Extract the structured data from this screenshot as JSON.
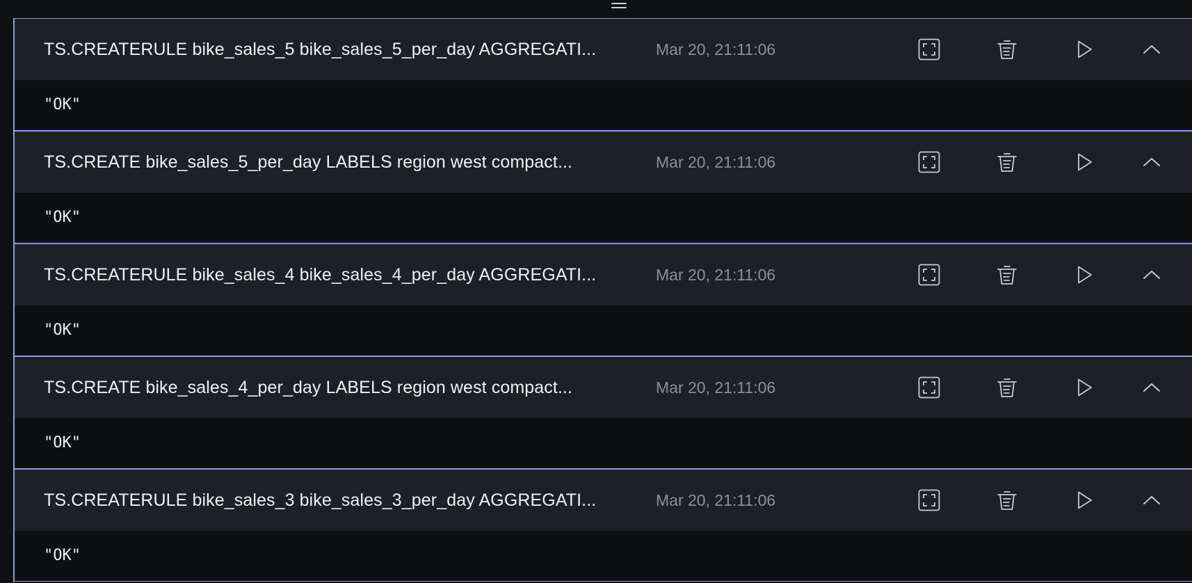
{
  "history": {
    "entries": [
      {
        "command": "TS.CREATERULE bike_sales_5 bike_sales_5_per_day AGGREGATI...",
        "timestamp": "Mar 20, 21:11:06",
        "result": "\"OK\""
      },
      {
        "command": "TS.CREATE bike_sales_5_per_day LABELS region west compact...",
        "timestamp": "Mar 20, 21:11:06",
        "result": "\"OK\""
      },
      {
        "command": "TS.CREATERULE bike_sales_4 bike_sales_4_per_day AGGREGATI...",
        "timestamp": "Mar 20, 21:11:06",
        "result": "\"OK\""
      },
      {
        "command": "TS.CREATE bike_sales_4_per_day LABELS region west compact...",
        "timestamp": "Mar 20, 21:11:06",
        "result": "\"OK\""
      },
      {
        "command": "TS.CREATERULE bike_sales_3 bike_sales_3_per_day AGGREGATI...",
        "timestamp": "Mar 20, 21:11:06",
        "result": "\"OK\""
      }
    ],
    "icons": {
      "expand": "fullscreen-icon",
      "delete": "trash-icon",
      "run": "play-icon",
      "collapse": "chevron-up-icon"
    }
  },
  "colors": {
    "background": "#0f1012",
    "header_background": "#1e2028",
    "entry_border": "#8b99e8",
    "text": "#eef0f4",
    "timestamp": "#8b8f99",
    "icon": "#c8ccd4"
  }
}
